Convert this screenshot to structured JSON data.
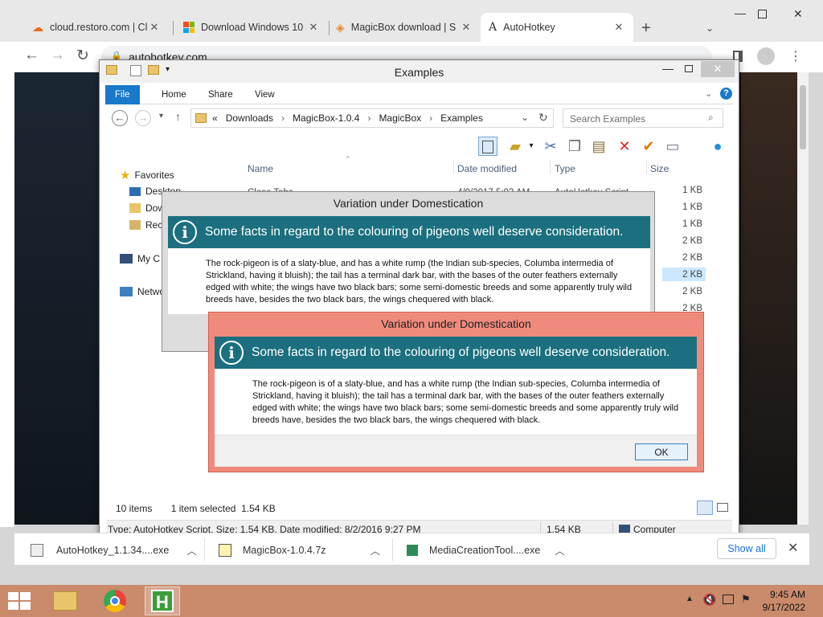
{
  "browser": {
    "tabs": [
      {
        "title": "cloud.restoro.com | Clou",
        "icon": "cloud-icon"
      },
      {
        "title": "Download Windows 10",
        "icon": "windows-logo-icon"
      },
      {
        "title": "MagicBox download | S",
        "icon": "diamond-icon"
      },
      {
        "title": "AutoHotkey",
        "icon": "autohotkey-a-icon",
        "active": true
      }
    ],
    "new_tab": "+",
    "url": "autohotkey.com",
    "downloads": [
      {
        "name": "AutoHotkey_1.1.34....exe"
      },
      {
        "name": "MagicBox-1.0.4.7z"
      },
      {
        "name": "MediaCreationTool....exe"
      }
    ],
    "show_all": "Show all"
  },
  "explorer": {
    "title": "Examples",
    "ribbon_tabs": [
      "File",
      "Home",
      "Share",
      "View"
    ],
    "breadcrumb": [
      "«",
      "Downloads",
      "MagicBox-1.0.4",
      "MagicBox",
      "Examples"
    ],
    "search_placeholder": "Search Examples",
    "nav": {
      "favorites": "Favorites",
      "desktop": "Desktop",
      "downloads": "Dow",
      "recent": "Rec",
      "computer": "My C",
      "network": "Netwo"
    },
    "columns": {
      "name": "Name",
      "date": "Date modified",
      "type": "Type",
      "size": "Size"
    },
    "partial_row": {
      "name": "Close Tabs",
      "date": "4/9/2017 5:03 AM",
      "type": "AutoHotkey Script"
    },
    "sizes": [
      "1 KB",
      "1 KB",
      "1 KB",
      "2 KB",
      "2 KB",
      "2 KB",
      "2 KB",
      "2 KB"
    ],
    "status_items": "10 items",
    "status_selected": "1 item selected  1.54 KB",
    "details": "Type: AutoHotkey Script, Size: 1.54 KB, Date modified: 8/2/2016 9:27 PM",
    "details_size": "1.54 KB",
    "details_location": "Computer"
  },
  "dialog_back": {
    "title": "Variation under Domestication",
    "heading": "Some facts in regard to the colouring of pigeons well deserve consideration.",
    "body": "The rock-pigeon is of a slaty-blue, and has a white rump (the Indian sub-species, Columba intermedia of Strickland, having it bluish); the tail has a terminal dark bar, with the bases of the outer feathers externally edged with white; the wings have two black bars; some semi-domestic breeds and some apparently truly wild breeds have, besides the two black bars, the wings chequered with black."
  },
  "dialog_front": {
    "title": "Variation under Domestication",
    "heading": "Some facts in regard to the colouring of pigeons well deserve consideration.",
    "body": "The rock-pigeon is of a slaty-blue, and has a white rump (the Indian sub-species, Columba intermedia of Strickland, having it bluish); the tail has a terminal dark bar, with the bases of the outer feathers externally edged with white; the wings have two black bars; some semi-domestic breeds and some apparently truly wild breeds have, besides the two black bars, the wings chequered with black.",
    "ok": "OK"
  },
  "taskbar": {
    "time": "9:45 AM",
    "date": "9/17/2022"
  },
  "colors": {
    "dialog_banner": "#1b6f7f",
    "dialog_frame_active": "#f08a7d",
    "taskbar": "#c98b6c",
    "explorer_file_tab": "#1979ca"
  }
}
